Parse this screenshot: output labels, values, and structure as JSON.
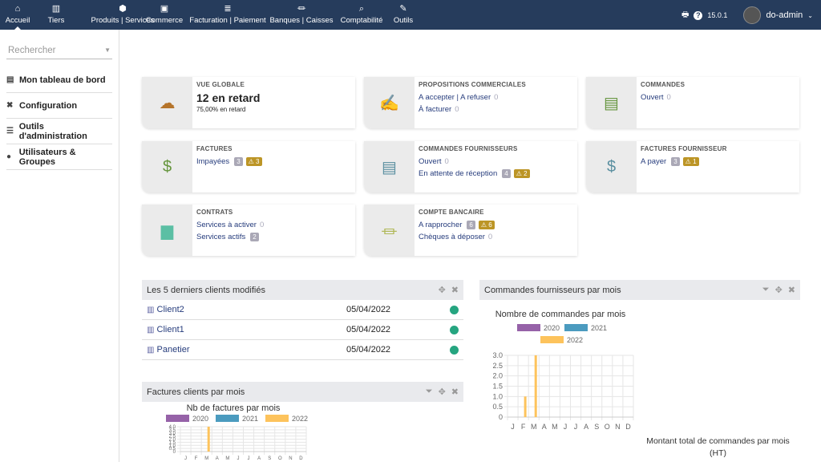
{
  "topbar": {
    "menus": [
      {
        "label": "Accueil",
        "icon": "home-icon",
        "glyph": "⌂"
      },
      {
        "label": "Tiers",
        "icon": "building-icon",
        "glyph": "▥"
      },
      {
        "label": "Produits | Services",
        "icon": "cube-icon",
        "glyph": "⬢"
      },
      {
        "label": "Commerce",
        "icon": "suitcase-icon",
        "glyph": "▣"
      },
      {
        "label": "Facturation | Paiement",
        "icon": "coins-icon",
        "glyph": "≣"
      },
      {
        "label": "Banques | Caisses",
        "icon": "bank-icon",
        "glyph": "⏛"
      },
      {
        "label": "Comptabilité",
        "icon": "search-dollar-icon",
        "glyph": "⌕"
      },
      {
        "label": "Outils",
        "icon": "wrench-icon",
        "glyph": "✎"
      }
    ],
    "version": "15.0.1",
    "user": "do-admin"
  },
  "sidebar": {
    "search_placeholder": "Rechercher",
    "items": [
      {
        "label": "Mon tableau de bord",
        "glyph": "▤"
      },
      {
        "label": "Configuration",
        "glyph": "✖"
      },
      {
        "label": "Outils d'administration",
        "glyph": "☰"
      },
      {
        "label": "Utilisateurs & Groupes",
        "glyph": "●"
      }
    ]
  },
  "boxes": {
    "global": {
      "title": "VUE GLOBALE",
      "big": "12 en retard",
      "sub": "75,00% en retard"
    },
    "propal": {
      "title": "PROPOSITIONS COMMERCIALES",
      "l1": "A accepter | A refuser",
      "c1": "0",
      "l2": "À facturer",
      "c2": "0"
    },
    "commandes": {
      "title": "COMMANDES",
      "l1": "Ouvert",
      "c1": "0"
    },
    "factures": {
      "title": "FACTURES",
      "l1": "Impayées",
      "b1": "3",
      "w1": "3"
    },
    "cmdfourn": {
      "title": "COMMANDES FOURNISSEURS",
      "l1": "Ouvert",
      "c1": "0",
      "l2": "En attente de réception",
      "b2": "4",
      "w2": "2"
    },
    "factfourn": {
      "title": "FACTURES FOURNISSEUR",
      "l1": "A payer",
      "b1": "3",
      "w1": "1"
    },
    "contrats": {
      "title": "CONTRATS",
      "l1": "Services à activer",
      "c1": "0",
      "l2": "Services actifs",
      "b2": "2"
    },
    "banque": {
      "title": "COMPTE BANCAIRE",
      "l1": "A rapprocher",
      "b1": "6",
      "w1": "6",
      "l2": "Chèques à déposer",
      "c2": "0"
    }
  },
  "clients": {
    "title": "Les 5 derniers clients modifiés",
    "rows": [
      {
        "name": "Client2",
        "date": "05/04/2022"
      },
      {
        "name": "Client1",
        "date": "05/04/2022"
      },
      {
        "name": "Panetier",
        "date": "05/04/2022"
      }
    ]
  },
  "factures_panel": {
    "title": "Factures clients par mois"
  },
  "cmd_panel": {
    "title": "Commandes fournisseurs par mois",
    "second_title": "Montant total de commandes par mois (HT)"
  },
  "colors": {
    "2020": "#9662a8",
    "2021": "#4b9bbf",
    "2022": "#fdc35c"
  },
  "chart_data": [
    {
      "type": "bar",
      "title": "Nombre de commandes par mois",
      "categories": [
        "J",
        "F",
        "M",
        "A",
        "M",
        "J",
        "J",
        "A",
        "S",
        "O",
        "N",
        "D"
      ],
      "series": [
        {
          "name": "2020",
          "values": [
            0,
            0,
            0,
            0,
            0,
            0,
            0,
            0,
            0,
            0,
            0,
            0
          ]
        },
        {
          "name": "2021",
          "values": [
            0,
            0,
            0,
            0,
            0,
            0,
            0,
            0,
            0,
            0,
            0,
            0
          ]
        },
        {
          "name": "2022",
          "values": [
            0,
            1,
            3,
            0,
            0,
            0,
            0,
            0,
            0,
            0,
            0,
            0
          ]
        }
      ],
      "ylim": [
        0,
        3
      ],
      "yticks": [
        "0",
        "0.5",
        "1.0",
        "1.5",
        "2.0",
        "2.5",
        "3.0"
      ],
      "grid": true,
      "legend": "top"
    },
    {
      "type": "bar",
      "title": "Nb de factures par mois",
      "categories": [
        "J",
        "F",
        "M",
        "A",
        "M",
        "J",
        "J",
        "A",
        "S",
        "O",
        "N",
        "D"
      ],
      "series": [
        {
          "name": "2020",
          "values": [
            0,
            0,
            0,
            0,
            0,
            0,
            0,
            0,
            0,
            0,
            0,
            0
          ]
        },
        {
          "name": "2021",
          "values": [
            0,
            0,
            0,
            0,
            0,
            0,
            0,
            0,
            0,
            0,
            0,
            0
          ]
        },
        {
          "name": "2022",
          "values": [
            0,
            0,
            4,
            0,
            0,
            0,
            0,
            0,
            0,
            0,
            0,
            0
          ]
        }
      ],
      "ylim": [
        0,
        4
      ],
      "yticks": [
        "0",
        "0.5",
        "1.0",
        "1.5",
        "2.0",
        "2.5",
        "3.0",
        "3.5",
        "4.0"
      ],
      "grid": true,
      "legend": "top"
    }
  ]
}
